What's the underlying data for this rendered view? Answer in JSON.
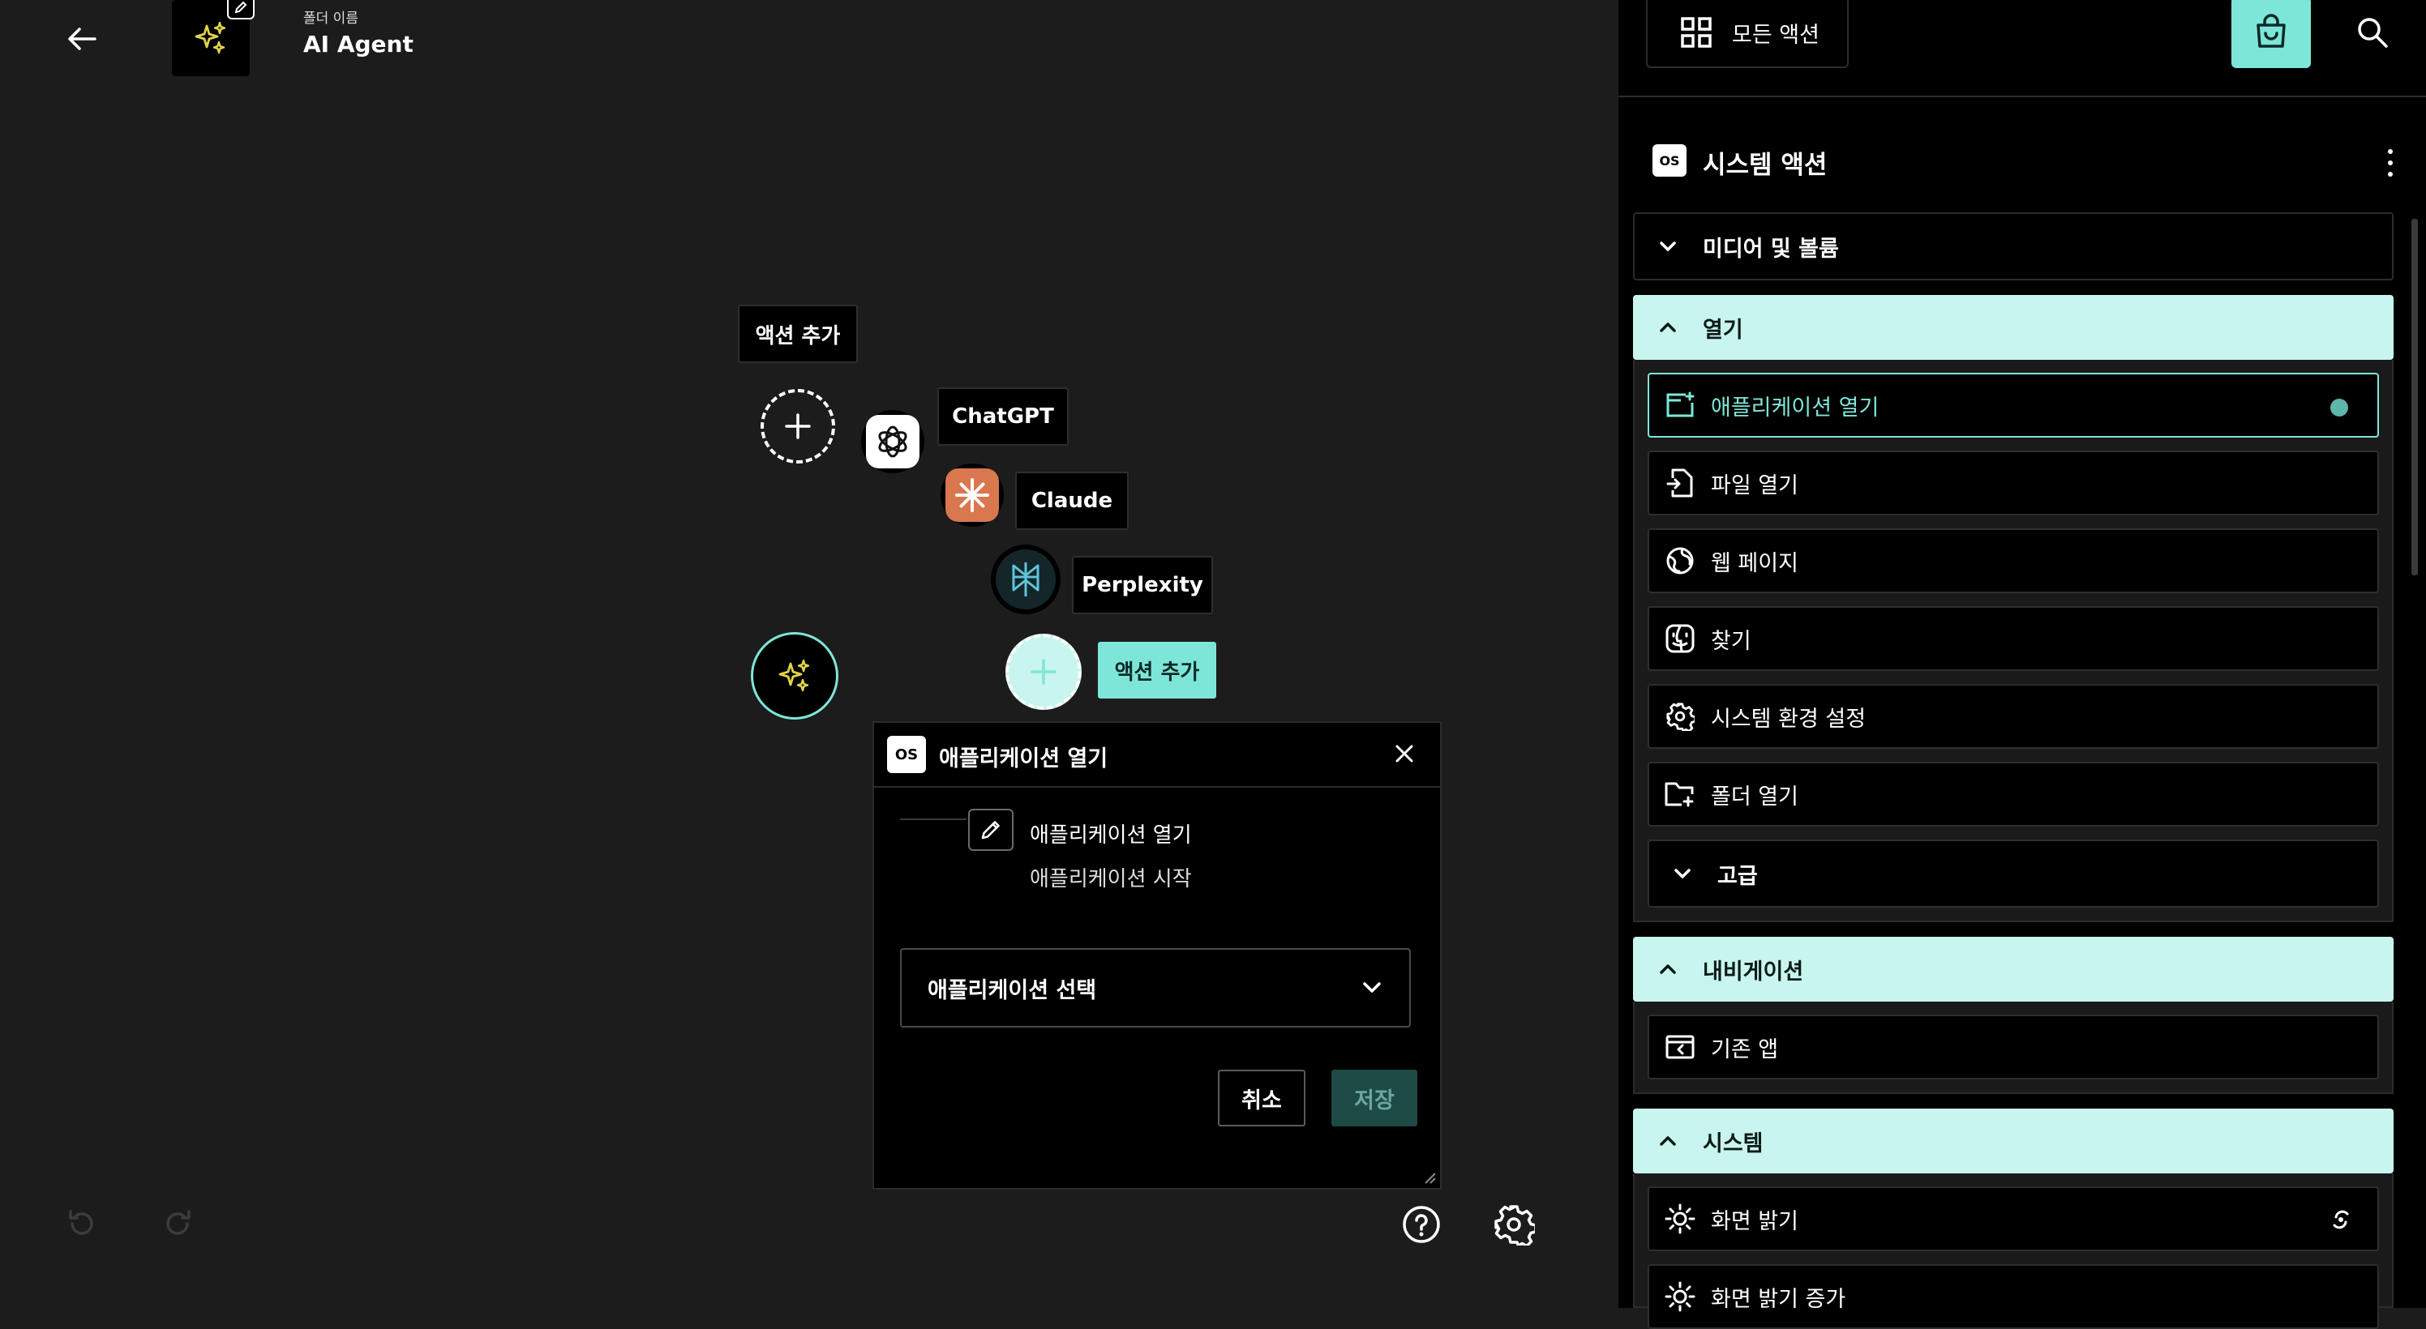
{
  "header": {
    "back_icon": "arrow-left-icon",
    "folder_label": "폴더 이름",
    "folder_name": "AI Agent",
    "folder_icon": "sparkles-icon",
    "edit_icon": "pencil-icon"
  },
  "canvas": {
    "add_action_top_label": "액션 추가",
    "apps": [
      {
        "name": "ChatGPT",
        "icon": "chatgpt-icon"
      },
      {
        "name": "Claude",
        "icon": "claude-icon"
      },
      {
        "name": "Perplexity",
        "icon": "perplexity-icon"
      }
    ],
    "add_action_active_label": "액션 추가",
    "undo_icon": "undo-icon",
    "redo_icon": "redo-icon",
    "help_icon": "help-icon",
    "settings_icon": "gear-icon"
  },
  "dialog": {
    "badge": "OS",
    "title": "애플리케이션 열기",
    "action_name": "애플리케이션 열기",
    "action_subtitle": "애플리케이션 시작",
    "select_placeholder": "애플리케이션 선택",
    "cancel_label": "취소",
    "save_label": "저장"
  },
  "panel": {
    "all_actions_label": "모든 액션",
    "category_badge": "OS",
    "category_title": "시스템 액션",
    "sections": [
      {
        "label": "미디어 및 볼륨",
        "expanded": false
      },
      {
        "label": "열기",
        "expanded": true,
        "items": [
          {
            "label": "애플리케이션 열기",
            "icon": "app-window-icon",
            "selected": true
          },
          {
            "label": "파일 열기",
            "icon": "file-open-icon"
          },
          {
            "label": "웹 페이지",
            "icon": "globe-icon"
          },
          {
            "label": "찾기",
            "icon": "finder-icon"
          },
          {
            "label": "시스템 환경 설정",
            "icon": "gear-icon"
          },
          {
            "label": "폴더 열기",
            "icon": "folder-icon"
          }
        ],
        "subsection": "고급"
      },
      {
        "label": "내비게이션",
        "expanded": true,
        "items": [
          {
            "label": "기존 앱",
            "icon": "window-back-icon"
          }
        ]
      },
      {
        "label": "시스템",
        "expanded": true,
        "items": [
          {
            "label": "화면 밝기",
            "icon": "sun-icon"
          },
          {
            "label": "화면 밝기 증가",
            "icon": "sun-icon"
          }
        ]
      }
    ]
  },
  "colors": {
    "accent": "#7ee6d8",
    "section_open_bg": "#c9f5ef",
    "background": "#1c1c1c",
    "panel_bg": "#000000"
  }
}
